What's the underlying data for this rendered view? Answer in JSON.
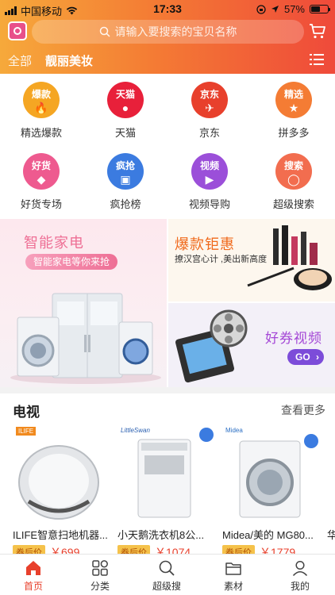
{
  "status": {
    "carrier": "中国移动",
    "time": "17:33",
    "battery": "57%",
    "battery_level": 0.57
  },
  "header": {
    "search_placeholder": "请输入要搜索的宝贝名称",
    "tabs": [
      {
        "label": "全部"
      },
      {
        "label": "靓丽美妆"
      }
    ]
  },
  "categories": [
    {
      "label": "精选爆款",
      "badge": "爆款",
      "icon": "flame-icon",
      "color": "#f5a623"
    },
    {
      "label": "天猫",
      "badge": "天猫",
      "icon": "tmall-cat-icon",
      "color": "#e8203a"
    },
    {
      "label": "京东",
      "badge": "京东",
      "icon": "jd-dog-icon",
      "color": "#e8402c"
    },
    {
      "label": "拼多多",
      "badge": "精选",
      "icon": "star-icon",
      "color": "#f47c34"
    },
    {
      "label": "好货专场",
      "badge": "好货",
      "icon": "diamond-icon",
      "color": "#ee5a8f"
    },
    {
      "label": "疯抢榜",
      "badge": "疯抢",
      "icon": "shopping-bag-icon",
      "color": "#3b7be0"
    },
    {
      "label": "视频导购",
      "badge": "视频",
      "icon": "video-icon",
      "color": "#9b4fd9"
    },
    {
      "label": "超级搜索",
      "badge": "搜索",
      "icon": "magnifier-icon",
      "color": "#f26d4f"
    }
  ],
  "banners": {
    "left": {
      "title": "智能家电",
      "button": "智能家电等你来抢"
    },
    "right_top": {
      "title": "爆款钜惠",
      "subtitle": "撩汉宫心计 ,美出新高度"
    },
    "right_bottom": {
      "title": "好券视频",
      "button": "GO"
    }
  },
  "section": {
    "title": "电视",
    "more": "查看更多",
    "products": [
      {
        "name": "ILIFE智意扫地机器...",
        "coupon": "券后价",
        "price": "￥699",
        "brand": "ILIFE"
      },
      {
        "name": "小天鹅洗衣机8公...",
        "coupon": "券后价",
        "price": "￥1074",
        "brand": "LittleSwan"
      },
      {
        "name": "Midea/美的 MG80...",
        "coupon": "券后价",
        "price": "￥1779",
        "brand": "Midea"
      },
      {
        "name": "华",
        "coupon": "",
        "price": "",
        "brand": ""
      }
    ]
  },
  "tabbar": [
    {
      "label": "首页",
      "icon": "home-icon",
      "active": true
    },
    {
      "label": "分类",
      "icon": "grid-icon",
      "active": false
    },
    {
      "label": "超级搜",
      "icon": "search-icon",
      "active": false
    },
    {
      "label": "素材",
      "icon": "folder-icon",
      "active": false
    },
    {
      "label": "我的",
      "icon": "user-icon",
      "active": false
    }
  ]
}
